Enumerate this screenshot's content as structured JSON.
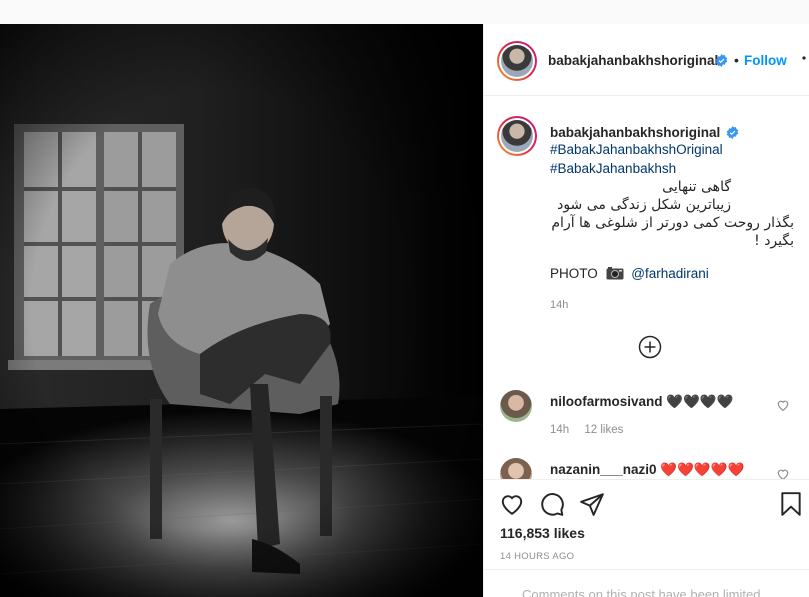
{
  "post": {
    "username": "babakjahanbakhshoriginal",
    "follow_label": "Follow",
    "dot": "•",
    "verified_icon": "verified-badge-icon",
    "accent": "#0095f6",
    "link_color": "#00376b"
  },
  "caption": {
    "username": "babakjahanbakhshoriginal",
    "hashtags": [
      "#BabakJahanbakhshOriginal",
      "#BabakJahanbakhsh"
    ],
    "lines": [
      "گاهی تنهایی",
      "زیباترین شکل زندگی می شود",
      "بگذار روحت کمی دورتر از شلوغی ها آرام",
      "بگیرد !"
    ],
    "photo_label": "PHOTO",
    "photo_icon": "camera-icon",
    "photo_mention": "@farhadirani",
    "time": "14h"
  },
  "comments": [
    {
      "username": "niloofarmosivand",
      "text": "🖤🖤🖤🖤",
      "time": "14h",
      "likes": "12 likes"
    },
    {
      "username": "nazanin___nazi0",
      "text": "❤️❤️❤️❤️❤️",
      "time": "",
      "likes": ""
    }
  ],
  "actions": {
    "icons": [
      "heart-icon",
      "comment-icon",
      "share-icon",
      "bookmark-icon"
    ]
  },
  "likes": "116,853 likes",
  "timestamp": "14 HOURS AGO",
  "footer": "Comments on this post have been limited."
}
